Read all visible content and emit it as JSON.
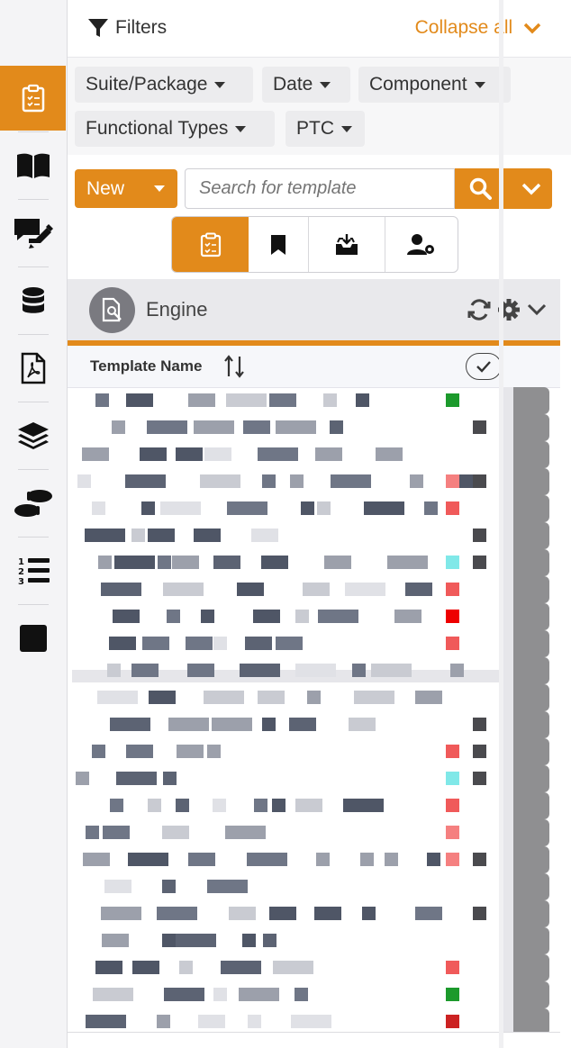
{
  "filters": {
    "title": "Filters",
    "collapse_label": "Collapse all",
    "chips": [
      "Suite/Package",
      "Date",
      "Component",
      "Functional Types",
      "PTC"
    ]
  },
  "toolbar": {
    "new_label": "New",
    "search_placeholder": "Search for template"
  },
  "engine": {
    "title": "Engine"
  },
  "table": {
    "col_template_name": "Template Name"
  },
  "colors": {
    "accent": "#e28a1b",
    "rail_bg": "#f4f4f6",
    "engine_bar": "#e9e9ec"
  },
  "rail_icons": [
    "clipboard-check-icon",
    "book-icon",
    "comments-edit-icon",
    "database-icon",
    "pdf-file-icon",
    "layers-icon",
    "footprints-icon",
    "numbered-list-icon",
    "square-icon"
  ]
}
